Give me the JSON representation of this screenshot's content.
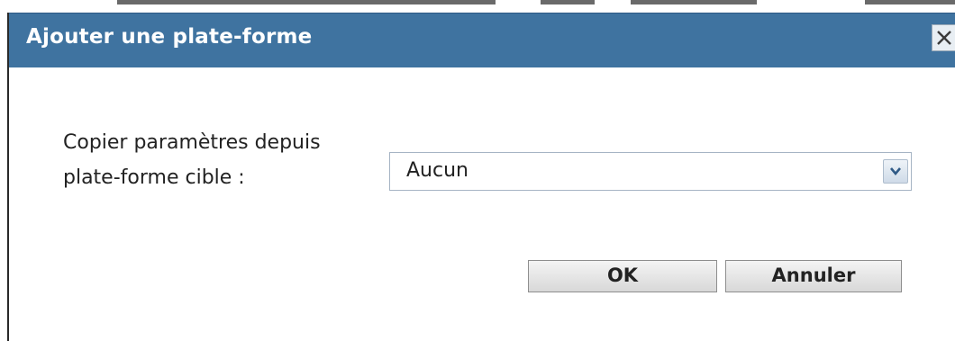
{
  "dialog": {
    "title": "Ajouter une plate-forme",
    "close_icon": "close-icon"
  },
  "form": {
    "copy_settings_label": "Copier paramètres depuis plate-forme cible :",
    "copy_settings_select": {
      "selected_value": "Aucun",
      "arrow_icon": "chevron-down-icon"
    }
  },
  "buttons": {
    "ok_label": "OK",
    "cancel_label": "Annuler"
  },
  "colors": {
    "titlebar": "#3f73a0",
    "title_text": "#ffffff"
  }
}
